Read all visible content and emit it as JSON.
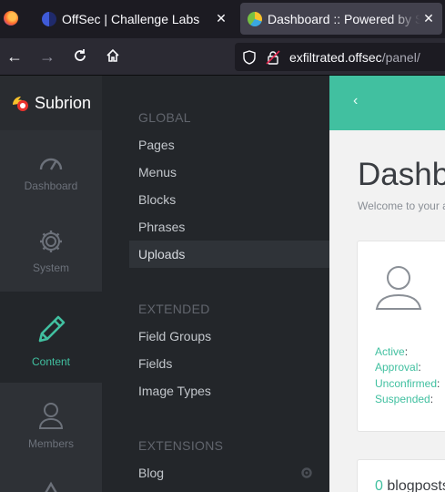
{
  "browser": {
    "tabs": [
      {
        "title": "OffSec | Challenge Labs",
        "active": false
      },
      {
        "title": "Dashboard :: Powered by Subrion",
        "active": true
      }
    ],
    "url_host": "exfiltrated.offsec",
    "url_path": "/panel/"
  },
  "app": {
    "brand": "Subrion",
    "iconbar": [
      {
        "label": "Dashboard",
        "icon": "gauge-icon",
        "active": false
      },
      {
        "label": "System",
        "icon": "gear-icon",
        "active": false
      },
      {
        "label": "Content",
        "icon": "pencil-icon",
        "active": true
      },
      {
        "label": "Members",
        "icon": "user-icon",
        "active": false
      }
    ],
    "submenu": {
      "global_heading": "GLOBAL",
      "global_items": [
        "Pages",
        "Menus",
        "Blocks",
        "Phrases",
        "Uploads"
      ],
      "active_item": "Uploads",
      "extended_heading": "EXTENDED",
      "extended_items": [
        "Field Groups",
        "Fields",
        "Image Types"
      ],
      "extensions_heading": "EXTENSIONS",
      "extensions_items": [
        "Blog"
      ]
    },
    "content": {
      "title": "Dashboard",
      "subtitle": "Welcome to your admin dashboard",
      "stats": [
        {
          "label": "Active",
          "value": ""
        },
        {
          "label": "Approval",
          "value": ""
        },
        {
          "label": "Unconfirmed",
          "value": ""
        },
        {
          "label": "Suspended",
          "value": ""
        }
      ],
      "blogposts_count": "0",
      "blogposts_label": "blogposts"
    }
  },
  "colors": {
    "accent": "#41c0a0",
    "sidebar_dark": "#23262a",
    "iconbar": "#2e3136"
  }
}
